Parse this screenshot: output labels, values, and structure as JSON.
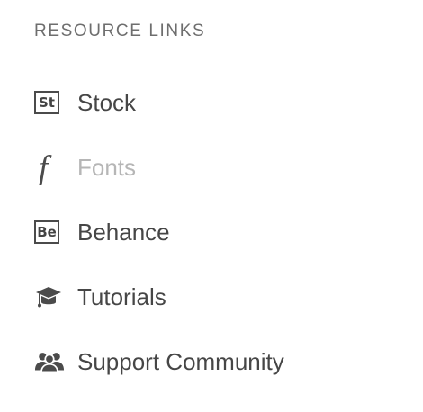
{
  "section": {
    "title": "RESOURCE LINKS"
  },
  "links": [
    {
      "label": "Stock",
      "icon": "stock-icon",
      "icon_text": "St",
      "enabled": true
    },
    {
      "label": "Fonts",
      "icon": "fonts-icon",
      "icon_text": "f",
      "enabled": false
    },
    {
      "label": "Behance",
      "icon": "behance-icon",
      "icon_text": "Be",
      "enabled": true
    },
    {
      "label": "Tutorials",
      "icon": "graduation-cap-icon",
      "enabled": true
    },
    {
      "label": "Support Community",
      "icon": "people-icon",
      "enabled": true
    }
  ],
  "colors": {
    "background": "#ffffff",
    "text": "#464646",
    "muted_text": "#b6b6b6",
    "section_title": "#6e6e6e",
    "icon": "#4b4b4b"
  }
}
